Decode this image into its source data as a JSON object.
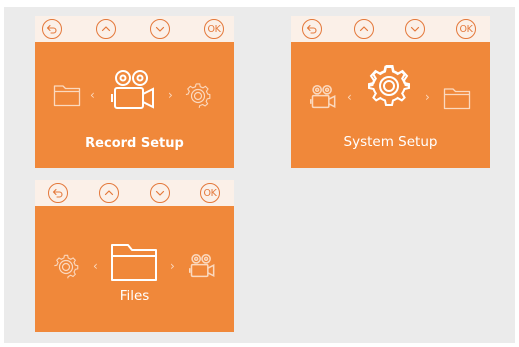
{
  "colors": {
    "panel": "#f0883a",
    "bar": "#fbf0e8",
    "button": "#e4783a",
    "icon": "#ffffff",
    "icon_dim": "#fbd9bf"
  },
  "buttons": {
    "back": "back-icon",
    "up": "up-icon",
    "down": "down-icon",
    "ok": "OK"
  },
  "screens": [
    {
      "id": "record",
      "label": "Record Setup",
      "left_icon": "folder-icon",
      "center_icon": "camera-icon",
      "right_icon": "gear-icon"
    },
    {
      "id": "system",
      "label": "System Setup",
      "left_icon": "camera-icon",
      "center_icon": "gear-icon",
      "right_icon": "folder-icon"
    },
    {
      "id": "files",
      "label": "Files",
      "left_icon": "gear-icon",
      "center_icon": "folder-icon",
      "right_icon": "camera-icon"
    }
  ],
  "chevrons": {
    "prev": "‹",
    "next": "›"
  }
}
